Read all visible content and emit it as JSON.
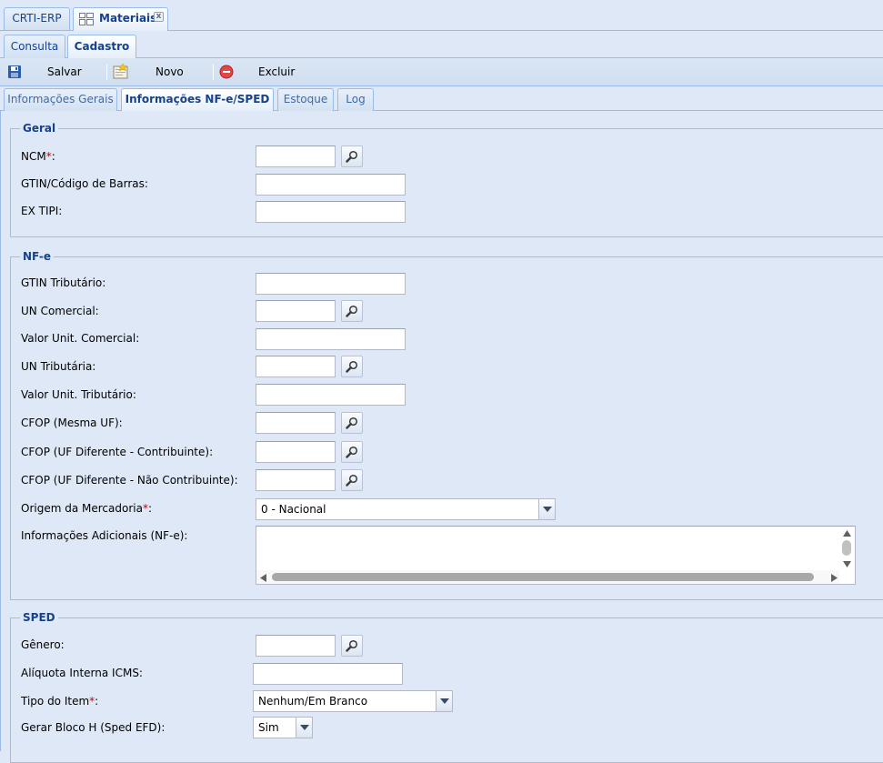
{
  "app_tabs": [
    {
      "label": "CRTI-ERP"
    },
    {
      "label": "Materiais",
      "icon": "grid-icon",
      "close": "x"
    }
  ],
  "sub_tabs": [
    {
      "label": "Consulta"
    },
    {
      "label": "Cadastro",
      "active": true
    }
  ],
  "toolbar": {
    "save_label": "Salvar",
    "new_label": "Novo",
    "delete_label": "Excluir"
  },
  "form_tabs": [
    {
      "label": "Informações Gerais"
    },
    {
      "label": "Informações NF-e/SPED",
      "active": true
    },
    {
      "label": "Estoque"
    },
    {
      "label": "Log"
    }
  ],
  "required_marker": "*",
  "geral": {
    "legend": "Geral",
    "ncm_label": "NCM",
    "gtin_label": "GTIN/Código de Barras:",
    "ex_tipi_label": "EX TIPI:"
  },
  "nfe": {
    "legend": "NF-e",
    "gtin_trib_label": "GTIN Tributário:",
    "un_comercial_label": "UN Comercial:",
    "valor_unit_comercial_label": "Valor Unit. Comercial:",
    "un_tributaria_label": "UN Tributária:",
    "valor_unit_tributario_label": "Valor Unit. Tributário:",
    "cfop_mesma_uf_label": "CFOP (Mesma UF):",
    "cfop_contribuinte_label": "CFOP (UF Diferente - Contribuinte):",
    "cfop_nao_contribuinte_label": "CFOP (UF Diferente - Não Contribuinte):",
    "origem_label": "Origem da Mercadoria",
    "origem_value": "0 - Nacional",
    "info_adicionais_label": "Informações Adicionais (NF-e):"
  },
  "sped": {
    "legend": "SPED",
    "genero_label": "Gênero:",
    "aliquota_label": "Alíquota Interna ICMS:",
    "tipo_item_label": "Tipo do Item",
    "tipo_item_value": "Nenhum/Em Branco",
    "bloco_h_label": "Gerar Bloco H (Sped EFD):",
    "bloco_h_value": "Sim"
  },
  "colors": {
    "accent": "#15428b",
    "border": "#99bbe8",
    "background": "#dfe8f6",
    "required": "#cc0000"
  }
}
